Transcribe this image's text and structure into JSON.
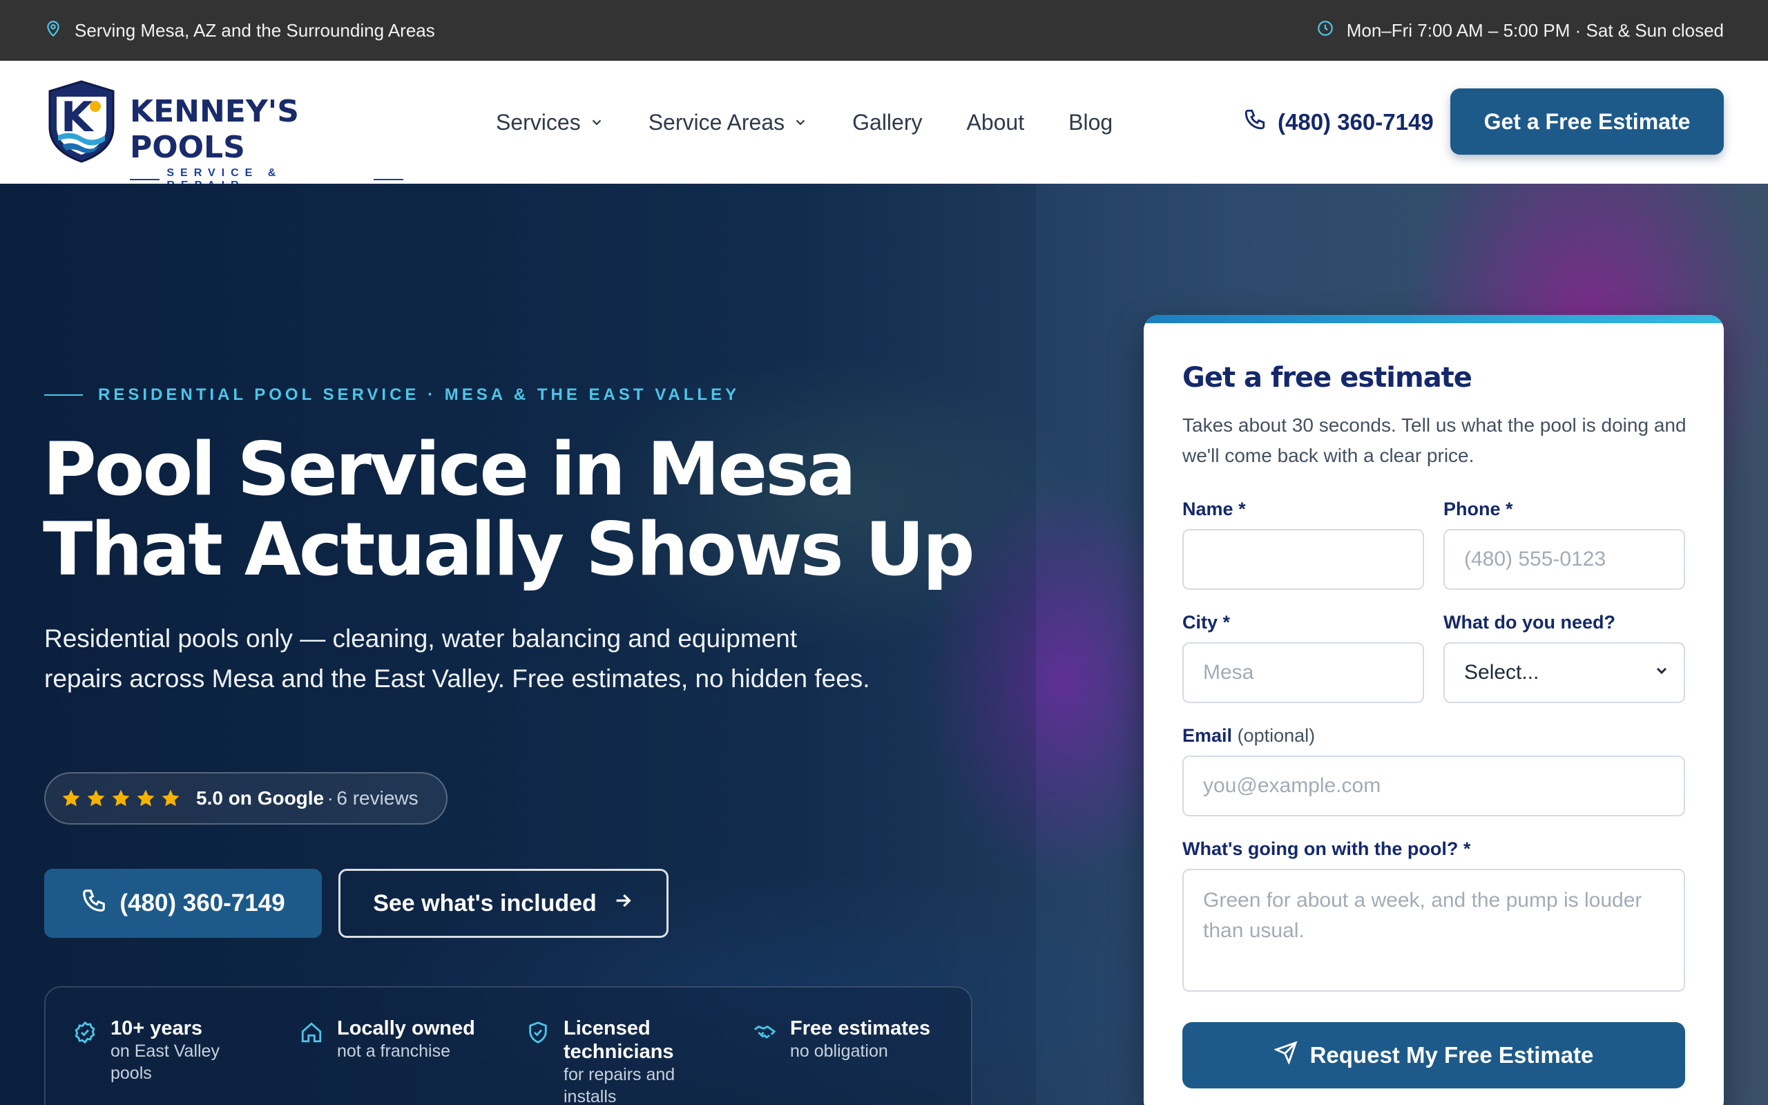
{
  "topbar": {
    "location": "Serving Mesa, AZ and the Surrounding Areas",
    "hours": "Mon–Fri 7:00 AM – 5:00 PM · Sat & Sun closed"
  },
  "header": {
    "logo_name": "KENNEY'S POOLS",
    "logo_tagline": "SERVICE & REPAIR",
    "nav": [
      {
        "label": "Services",
        "dropdown": true
      },
      {
        "label": "Service Areas",
        "dropdown": true
      },
      {
        "label": "Gallery",
        "dropdown": false
      },
      {
        "label": "About",
        "dropdown": false
      },
      {
        "label": "Blog",
        "dropdown": false
      }
    ],
    "phone": "(480) 360-7149",
    "cta_label": "Get a Free Estimate"
  },
  "hero": {
    "eyebrow": "RESIDENTIAL POOL SERVICE · MESA & THE EAST VALLEY",
    "title_line1": "Pool Service in Mesa",
    "title_line2": "That Actually Shows Up",
    "subtitle": "Residential pools only — cleaning, water balancing and equipment repairs across Mesa and the East Valley. Free estimates, no hidden fees.",
    "rating": {
      "stars": 5,
      "text": "5.0 on Google",
      "separator": "·",
      "count": "6 reviews"
    },
    "phone_button": "(480) 360-7149",
    "secondary_button": "See what's included",
    "trust": [
      {
        "title": "10+ years",
        "sub": "on East Valley pools",
        "icon": "badge-check-icon"
      },
      {
        "title": "Locally owned",
        "sub": "not a franchise",
        "icon": "home-icon"
      },
      {
        "title": "Licensed technicians",
        "sub": "for repairs and installs",
        "icon": "shield-check-icon"
      },
      {
        "title": "Free estimates",
        "sub": "no obligation",
        "icon": "handshake-icon"
      }
    ]
  },
  "form": {
    "title": "Get a free estimate",
    "subtitle": "Takes about 30 seconds. Tell us what the pool is doing and we'll come back with a clear price.",
    "name_label": "Name",
    "name_placeholder": "",
    "phone_label": "Phone",
    "phone_placeholder": "(480) 555-0123",
    "city_label": "City",
    "city_placeholder": "Mesa",
    "need_label": "What do you need?",
    "need_value": "Select...",
    "email_label": "Email",
    "email_optional": "(optional)",
    "email_placeholder": "you@example.com",
    "issue_label": "What's going on with the pool?",
    "issue_placeholder": "Green for about a week, and the pump is louder than usual.",
    "required_mark": "*",
    "submit_label": "Request My Free Estimate"
  },
  "colors": {
    "primary": "#1d5a8a",
    "navy": "#14286b",
    "accent": "#4cc6e8",
    "star": "#f5b301",
    "topbar": "#333333"
  }
}
